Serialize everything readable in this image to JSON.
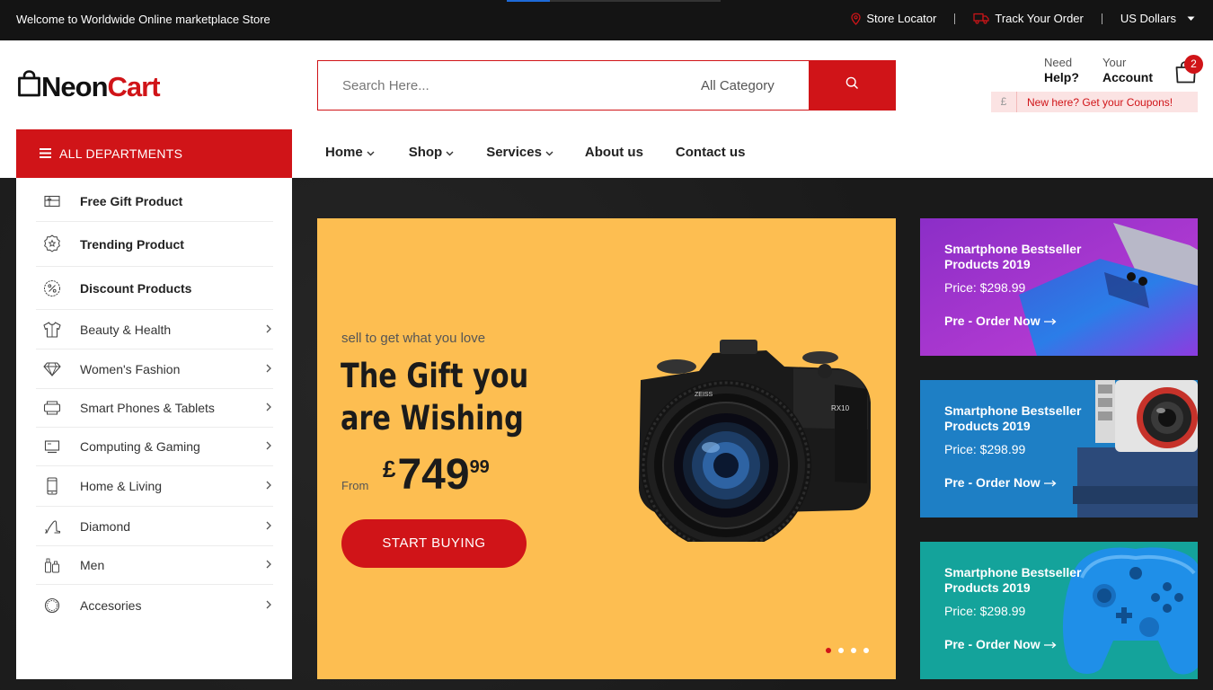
{
  "topbar": {
    "welcome": "Welcome to Worldwide Online marketplace Store",
    "store_locator": "Store Locator",
    "track_order": "Track Your Order",
    "currency": "US Dollars"
  },
  "header": {
    "logo_part1": "Neon",
    "logo_part2": "Cart",
    "search_placeholder": "Search Here...",
    "category": "All Category",
    "help_small": "Need",
    "help_big": "Help?",
    "account_small": "Your",
    "account_big": "Account",
    "cart_count": "2",
    "coupon_currency": "£",
    "coupon_text": "New here? Get your Coupons!"
  },
  "departments": {
    "label": "ALL DEPARTMENTS",
    "items": [
      {
        "label": "Free Gift Product",
        "icon": "gift-card-icon"
      },
      {
        "label": "Trending Product",
        "icon": "badge-icon"
      },
      {
        "label": "Discount Products",
        "icon": "discount-icon"
      },
      {
        "label": "Beauty & Health",
        "icon": "shirt-icon"
      },
      {
        "label": "Women's Fashion",
        "icon": "diamond-icon"
      },
      {
        "label": "Smart Phones & Tablets",
        "icon": "printer-icon"
      },
      {
        "label": "Computing & Gaming",
        "icon": "monitor-icon"
      },
      {
        "label": "Home & Living",
        "icon": "phone-icon"
      },
      {
        "label": "Diamond",
        "icon": "heel-icon"
      },
      {
        "label": "Men",
        "icon": "bottles-icon"
      },
      {
        "label": "Accesories",
        "icon": "ring-icon"
      }
    ]
  },
  "nav": {
    "items": [
      {
        "label": "Home",
        "has_dropdown": true
      },
      {
        "label": "Shop",
        "has_dropdown": true
      },
      {
        "label": "Services",
        "has_dropdown": true
      },
      {
        "label": "About us",
        "has_dropdown": false
      },
      {
        "label": "Contact us",
        "has_dropdown": false
      }
    ]
  },
  "slider": {
    "tagline": "sell to get what you love",
    "title": "The Gift you are Wishing",
    "from_label": "From",
    "currency": "£",
    "price_main": "749",
    "price_cents": "99",
    "button": "START BUYING",
    "slides": 4,
    "active_slide": 1
  },
  "promos": [
    {
      "title": "Smartphone Bestseller Products 2019",
      "price": "Price: $298.99",
      "cta": "Pre - Order Now",
      "bg": "#9b2fc9"
    },
    {
      "title": "Smartphone Bestseller Products 2019",
      "price": "Price: $298.99",
      "cta": "Pre - Order Now",
      "bg": "#1e7fc5"
    },
    {
      "title": "Smartphone Bestseller Products 2019",
      "price": "Price: $298.99",
      "cta": "Pre - Order Now",
      "bg": "#14a39b"
    }
  ],
  "colors": {
    "accent": "#d01418",
    "topbar": "#141414",
    "hero_yellow": "#fdbe51"
  }
}
